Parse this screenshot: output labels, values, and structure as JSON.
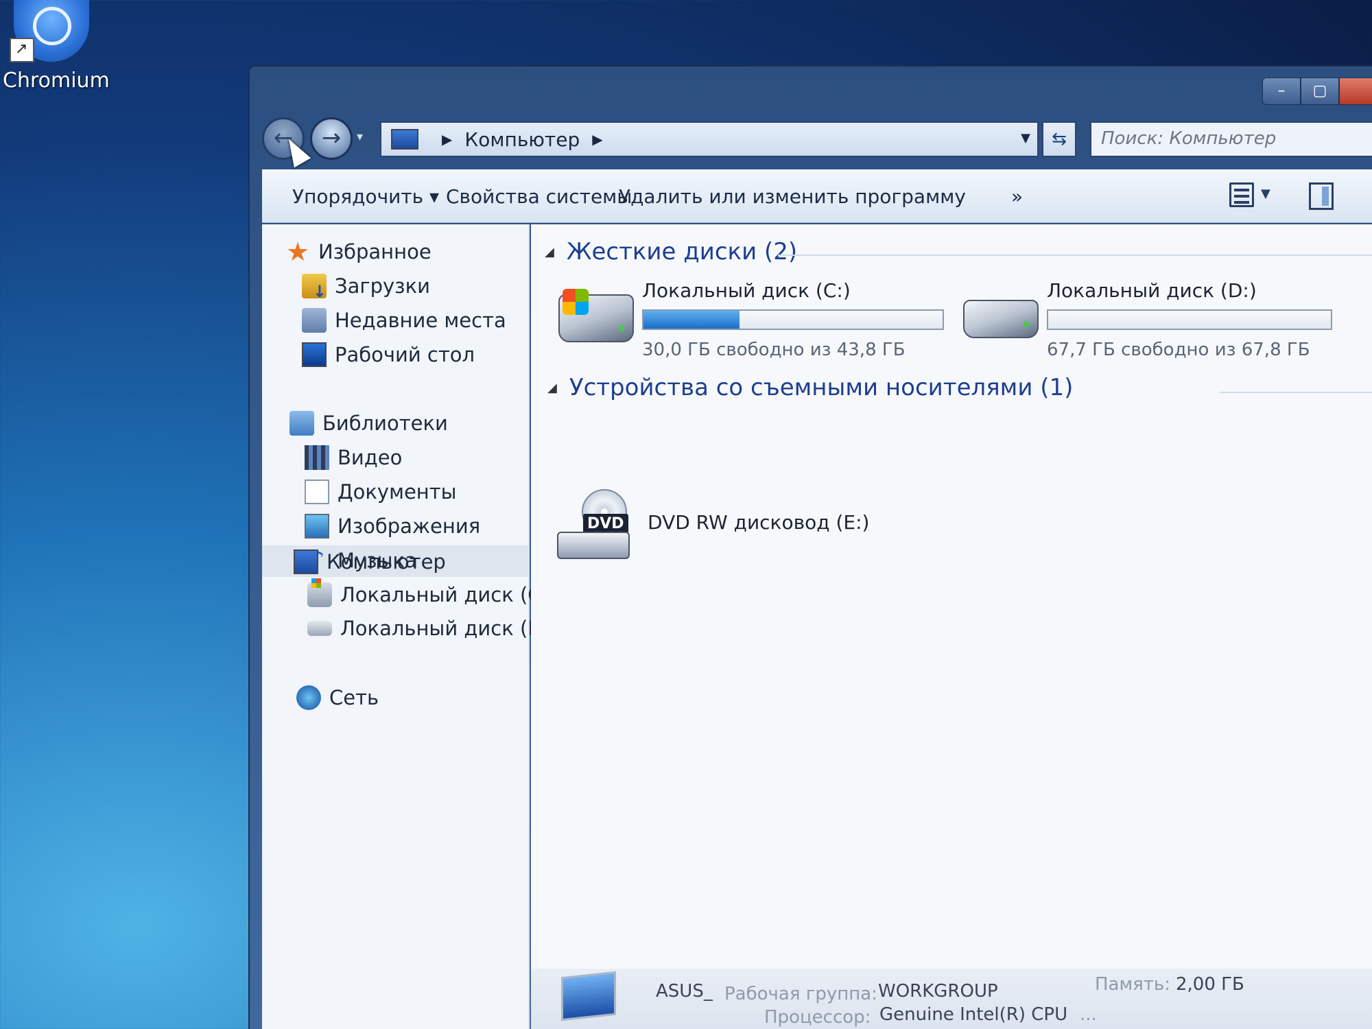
{
  "desktop": {
    "icon_label": "Chromium"
  },
  "window": {
    "address": {
      "location": "Компьютер"
    },
    "search": {
      "placeholder": "Поиск: Компьютер"
    },
    "toolbar": {
      "organize": "Упорядочить ▾",
      "system_properties": "Свойства системы",
      "uninstall": "Удалить или изменить программу",
      "more": "»"
    },
    "sidebar": {
      "favorites": {
        "label": "Избранное",
        "items": [
          "Загрузки",
          "Недавние места",
          "Рабочий стол"
        ]
      },
      "libraries": {
        "label": "Библиотеки",
        "items": [
          "Видео",
          "Документы",
          "Изображения",
          "Музыка"
        ]
      },
      "computer": {
        "label": "Компьютер",
        "items": [
          "Локальный диск (C",
          "Локальный диск (D"
        ]
      },
      "network": {
        "label": "Сеть"
      }
    },
    "content": {
      "hard_disks": {
        "header": "Жесткие диски (2)",
        "drives": [
          {
            "name": "Локальный диск (C:)",
            "free_text": "30,0 ГБ свободно из 43,8 ГБ",
            "used_fraction": 0.32
          },
          {
            "name": "Локальный диск (D:)",
            "free_text": "67,7 ГБ свободно из 67,8 ГБ",
            "used_fraction": 0.0
          }
        ]
      },
      "removable": {
        "header": "Устройства со съемными носителями (1)",
        "devices": [
          {
            "name": "DVD RW дисковод (E:)",
            "badge": "DVD"
          }
        ]
      }
    },
    "details": {
      "pc_name": "ASUS_",
      "workgroup_label": "Рабочая группа:",
      "workgroup_value": "WORKGROUP",
      "memory_label": "Память:",
      "memory_value": "2,00 ГБ",
      "cpu_label": "Процессор:",
      "cpu_value": "Genuine Intel(R) CPU",
      "cpu_more": "..."
    }
  }
}
